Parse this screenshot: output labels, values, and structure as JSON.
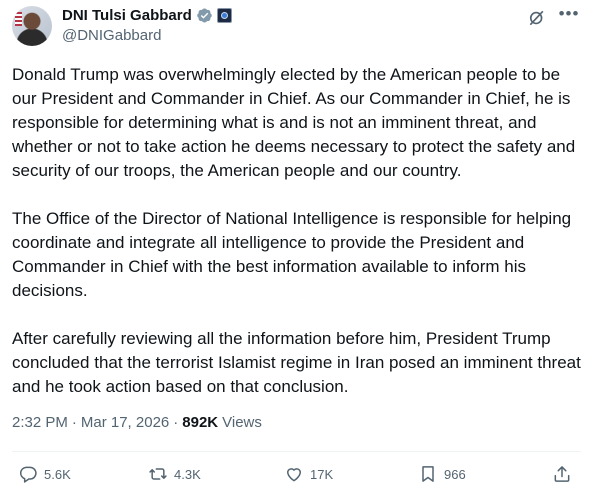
{
  "author": {
    "display_name": "DNI Tulsi Gabbard",
    "handle": "@DNIGabbard",
    "verified": true
  },
  "tweet": {
    "paragraphs": [
      "Donald Trump was overwhelmingly elected by the American people to be our President and Commander in Chief. As our Commander in Chief, he is responsible for determining what is and is not an imminent threat, and whether or not to take action he deems necessary to protect the safety and security of our troops, the American people and our country.",
      "The Office of the Director of National Intelligence is responsible for helping coordinate and integrate all intelligence to provide the President and Commander in Chief with the best information available to inform his decisions.",
      "After carefully reviewing all the information before him, President Trump concluded that the terrorist Islamist regime in Iran posed an imminent threat and he took action based on that conclusion."
    ],
    "time": "2:32 PM",
    "separator": "·",
    "date": "Mar 17, 2026",
    "views_count": "892K",
    "views_label": "Views"
  },
  "actions": {
    "replies": "5.6K",
    "reposts": "4.3K",
    "likes": "17K",
    "bookmarks": "966"
  },
  "icons": {
    "verified": "verified-badge-icon",
    "org": "odni-seal-icon",
    "grok": "grok-icon",
    "more": "more-icon",
    "reply": "reply-icon",
    "repost": "repost-icon",
    "like": "heart-icon",
    "bookmark": "bookmark-icon",
    "share": "share-icon"
  },
  "colors": {
    "text": "#0f1419",
    "secondary": "#536471",
    "verified": "#829aab",
    "divider": "#eff3f4"
  }
}
